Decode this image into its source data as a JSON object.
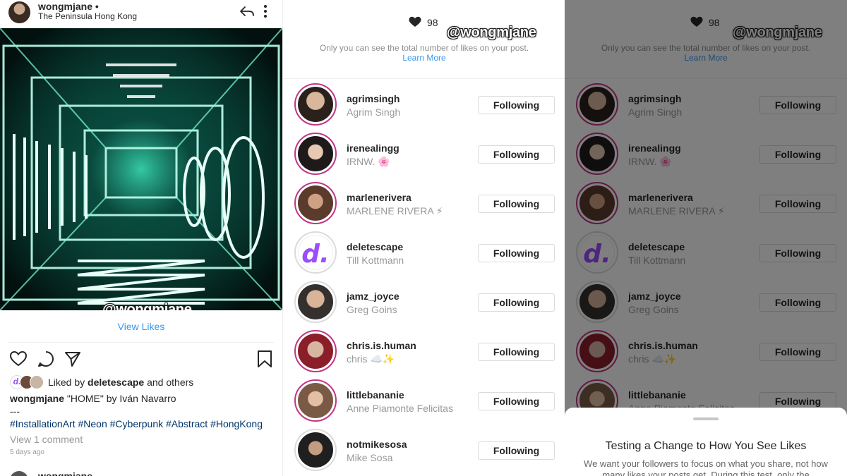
{
  "post": {
    "username": "wongmjane •",
    "location": "The Peninsula Hong Kong",
    "watermark": "@wongmjane",
    "view_likes": "View Likes",
    "liked_by_prefix": "Liked by",
    "liked_by_user": "deletescape",
    "liked_by_suffix": "and others",
    "caption_user": "wongmjane",
    "caption_text": "\"HOME\" by Iván Navarro",
    "caption_dashes": "---",
    "hashtags": "#InstallationArt #Neon #Cyberpunk #Abstract #HongKong",
    "view_comments": "View 1 comment",
    "timestamp": "5 days ago",
    "next_post_user": "wongmjane"
  },
  "likes": {
    "count": "98",
    "note": "Only you can see the total number of likes on your post.",
    "learn_more": "Learn More",
    "watermark": "@wongmjane",
    "follow_label": "Following",
    "users": [
      {
        "username": "agrimsingh",
        "name": "Agrim Singh"
      },
      {
        "username": "irenealingg",
        "name": "IRNW. 🌸"
      },
      {
        "username": "marlenerivera",
        "name": "MARLENE RIVERA ⚡"
      },
      {
        "username": "deletescape",
        "name": "Till Kottmann"
      },
      {
        "username": "jamz_joyce",
        "name": "Greg Goins"
      },
      {
        "username": "chris.is.human",
        "name": "chris ☁️✨"
      },
      {
        "username": "littlebananie",
        "name": "Anne Piamonte Felicitas"
      },
      {
        "username": "notmikesosa",
        "name": "Mike Sosa"
      }
    ]
  },
  "sheet": {
    "title": "Testing a Change to How You See Likes",
    "body": "We want your followers to focus on what you share, not how many likes your posts get. During this test, only the"
  },
  "icons": [
    "reply-icon",
    "more-icon",
    "heart-icon",
    "comment-icon",
    "share-icon",
    "bookmark-icon"
  ],
  "colors": {
    "link": "#3897f0",
    "hashtag": "#003569",
    "story_ring": "#c13584",
    "neon": "#3ff5c8"
  }
}
